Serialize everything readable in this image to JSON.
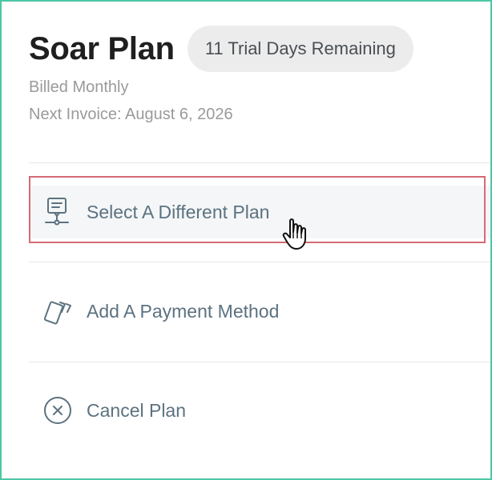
{
  "plan": {
    "title": "Soar Plan",
    "trial_badge": "11 Trial Days Remaining",
    "billing": "Billed Monthly",
    "next_invoice": "Next Invoice: August 6, 2026"
  },
  "actions": [
    {
      "label": "Select A Different Plan",
      "icon": "plan-sign-icon",
      "state": "hover"
    },
    {
      "label": "Add A Payment Method",
      "icon": "payment-cards-icon"
    },
    {
      "label": "Cancel Plan",
      "icon": "close-circle-icon"
    }
  ],
  "colors": {
    "frame_border": "#4fc7a6",
    "highlight_border": "#d46a74",
    "action_text": "#5c7280",
    "badge_bg": "#ececec"
  }
}
